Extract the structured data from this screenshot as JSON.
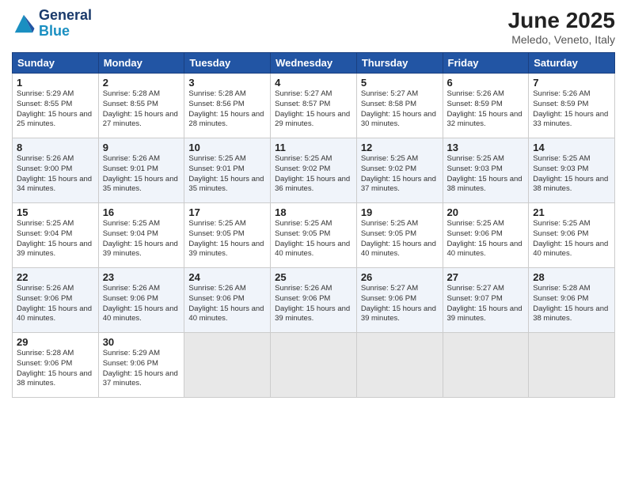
{
  "header": {
    "logo_line1": "General",
    "logo_line2": "Blue",
    "title": "June 2025",
    "subtitle": "Meledo, Veneto, Italy"
  },
  "weekdays": [
    "Sunday",
    "Monday",
    "Tuesday",
    "Wednesday",
    "Thursday",
    "Friday",
    "Saturday"
  ],
  "weeks": [
    [
      {
        "day": 1,
        "sunrise": "5:29 AM",
        "sunset": "8:55 PM",
        "daylight": "15 hours and 25 minutes."
      },
      {
        "day": 2,
        "sunrise": "5:28 AM",
        "sunset": "8:55 PM",
        "daylight": "15 hours and 27 minutes."
      },
      {
        "day": 3,
        "sunrise": "5:28 AM",
        "sunset": "8:56 PM",
        "daylight": "15 hours and 28 minutes."
      },
      {
        "day": 4,
        "sunrise": "5:27 AM",
        "sunset": "8:57 PM",
        "daylight": "15 hours and 29 minutes."
      },
      {
        "day": 5,
        "sunrise": "5:27 AM",
        "sunset": "8:58 PM",
        "daylight": "15 hours and 30 minutes."
      },
      {
        "day": 6,
        "sunrise": "5:26 AM",
        "sunset": "8:59 PM",
        "daylight": "15 hours and 32 minutes."
      },
      {
        "day": 7,
        "sunrise": "5:26 AM",
        "sunset": "8:59 PM",
        "daylight": "15 hours and 33 minutes."
      }
    ],
    [
      {
        "day": 8,
        "sunrise": "5:26 AM",
        "sunset": "9:00 PM",
        "daylight": "15 hours and 34 minutes."
      },
      {
        "day": 9,
        "sunrise": "5:26 AM",
        "sunset": "9:01 PM",
        "daylight": "15 hours and 35 minutes."
      },
      {
        "day": 10,
        "sunrise": "5:25 AM",
        "sunset": "9:01 PM",
        "daylight": "15 hours and 35 minutes."
      },
      {
        "day": 11,
        "sunrise": "5:25 AM",
        "sunset": "9:02 PM",
        "daylight": "15 hours and 36 minutes."
      },
      {
        "day": 12,
        "sunrise": "5:25 AM",
        "sunset": "9:02 PM",
        "daylight": "15 hours and 37 minutes."
      },
      {
        "day": 13,
        "sunrise": "5:25 AM",
        "sunset": "9:03 PM",
        "daylight": "15 hours and 38 minutes."
      },
      {
        "day": 14,
        "sunrise": "5:25 AM",
        "sunset": "9:03 PM",
        "daylight": "15 hours and 38 minutes."
      }
    ],
    [
      {
        "day": 15,
        "sunrise": "5:25 AM",
        "sunset": "9:04 PM",
        "daylight": "15 hours and 39 minutes."
      },
      {
        "day": 16,
        "sunrise": "5:25 AM",
        "sunset": "9:04 PM",
        "daylight": "15 hours and 39 minutes."
      },
      {
        "day": 17,
        "sunrise": "5:25 AM",
        "sunset": "9:05 PM",
        "daylight": "15 hours and 39 minutes."
      },
      {
        "day": 18,
        "sunrise": "5:25 AM",
        "sunset": "9:05 PM",
        "daylight": "15 hours and 40 minutes."
      },
      {
        "day": 19,
        "sunrise": "5:25 AM",
        "sunset": "9:05 PM",
        "daylight": "15 hours and 40 minutes."
      },
      {
        "day": 20,
        "sunrise": "5:25 AM",
        "sunset": "9:06 PM",
        "daylight": "15 hours and 40 minutes."
      },
      {
        "day": 21,
        "sunrise": "5:25 AM",
        "sunset": "9:06 PM",
        "daylight": "15 hours and 40 minutes."
      }
    ],
    [
      {
        "day": 22,
        "sunrise": "5:26 AM",
        "sunset": "9:06 PM",
        "daylight": "15 hours and 40 minutes."
      },
      {
        "day": 23,
        "sunrise": "5:26 AM",
        "sunset": "9:06 PM",
        "daylight": "15 hours and 40 minutes."
      },
      {
        "day": 24,
        "sunrise": "5:26 AM",
        "sunset": "9:06 PM",
        "daylight": "15 hours and 40 minutes."
      },
      {
        "day": 25,
        "sunrise": "5:26 AM",
        "sunset": "9:06 PM",
        "daylight": "15 hours and 39 minutes."
      },
      {
        "day": 26,
        "sunrise": "5:27 AM",
        "sunset": "9:06 PM",
        "daylight": "15 hours and 39 minutes."
      },
      {
        "day": 27,
        "sunrise": "5:27 AM",
        "sunset": "9:07 PM",
        "daylight": "15 hours and 39 minutes."
      },
      {
        "day": 28,
        "sunrise": "5:28 AM",
        "sunset": "9:06 PM",
        "daylight": "15 hours and 38 minutes."
      }
    ],
    [
      {
        "day": 29,
        "sunrise": "5:28 AM",
        "sunset": "9:06 PM",
        "daylight": "15 hours and 38 minutes."
      },
      {
        "day": 30,
        "sunrise": "5:29 AM",
        "sunset": "9:06 PM",
        "daylight": "15 hours and 37 minutes."
      },
      null,
      null,
      null,
      null,
      null
    ]
  ]
}
